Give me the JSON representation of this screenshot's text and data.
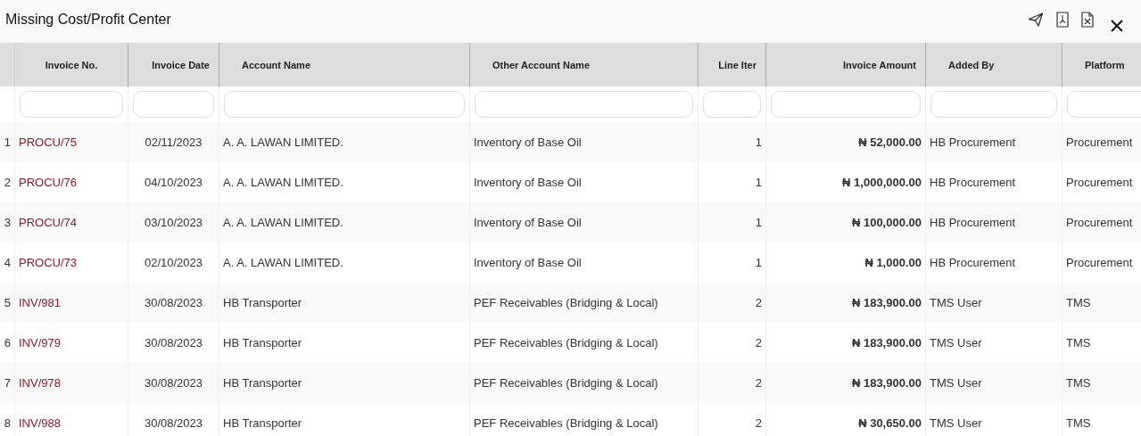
{
  "window": {
    "title": "Missing Cost/Profit Center"
  },
  "columns": [
    "Invoice No.",
    "Invoice Date",
    "Account Name",
    "Other Account Name",
    "Line Iter",
    "Invoice Amount",
    "Added By",
    "Platform"
  ],
  "rows": [
    {
      "index": "1",
      "invoice_no": "PROCU/75",
      "invoice_date": "02/11/2023",
      "account_name": "A. A. LAWAN LIMITED.",
      "other_account_name": "Inventory of Base Oil",
      "line_item": "1",
      "invoice_amount": "₦ 52,000.00",
      "added_by": "HB Procurement",
      "platform": "Procurement"
    },
    {
      "index": "2",
      "invoice_no": "PROCU/76",
      "invoice_date": "04/10/2023",
      "account_name": "A. A. LAWAN LIMITED.",
      "other_account_name": "Inventory of Base Oil",
      "line_item": "1",
      "invoice_amount": "₦ 1,000,000.00",
      "added_by": "HB Procurement",
      "platform": "Procurement"
    },
    {
      "index": "3",
      "invoice_no": "PROCU/74",
      "invoice_date": "03/10/2023",
      "account_name": "A. A. LAWAN LIMITED.",
      "other_account_name": "Inventory of Base Oil",
      "line_item": "1",
      "invoice_amount": "₦ 100,000.00",
      "added_by": "HB Procurement",
      "platform": "Procurement"
    },
    {
      "index": "4",
      "invoice_no": "PROCU/73",
      "invoice_date": "02/10/2023",
      "account_name": "A. A. LAWAN LIMITED.",
      "other_account_name": "Inventory of Base Oil",
      "line_item": "1",
      "invoice_amount": "₦ 1,000.00",
      "added_by": "HB Procurement",
      "platform": "Procurement"
    },
    {
      "index": "5",
      "invoice_no": "INV/981",
      "invoice_date": "30/08/2023",
      "account_name": "HB Transporter",
      "other_account_name": "PEF Receivables (Bridging & Local)",
      "line_item": "2",
      "invoice_amount": "₦ 183,900.00",
      "added_by": "TMS User",
      "platform": "TMS"
    },
    {
      "index": "6",
      "invoice_no": "INV/979",
      "invoice_date": "30/08/2023",
      "account_name": "HB Transporter",
      "other_account_name": "PEF Receivables (Bridging & Local)",
      "line_item": "2",
      "invoice_amount": "₦ 183,900.00",
      "added_by": "TMS User",
      "platform": "TMS"
    },
    {
      "index": "7",
      "invoice_no": "INV/978",
      "invoice_date": "30/08/2023",
      "account_name": "HB Transporter",
      "other_account_name": "PEF Receivables (Bridging & Local)",
      "line_item": "2",
      "invoice_amount": "₦ 183,900.00",
      "added_by": "TMS User",
      "platform": "TMS"
    },
    {
      "index": "8",
      "invoice_no": "INV/988",
      "invoice_date": "30/08/2023",
      "account_name": "HB Transporter",
      "other_account_name": "PEF Receivables (Bridging & Local)",
      "line_item": "2",
      "invoice_amount": "₦ 30,650.00",
      "added_by": "TMS User",
      "platform": "TMS"
    }
  ]
}
